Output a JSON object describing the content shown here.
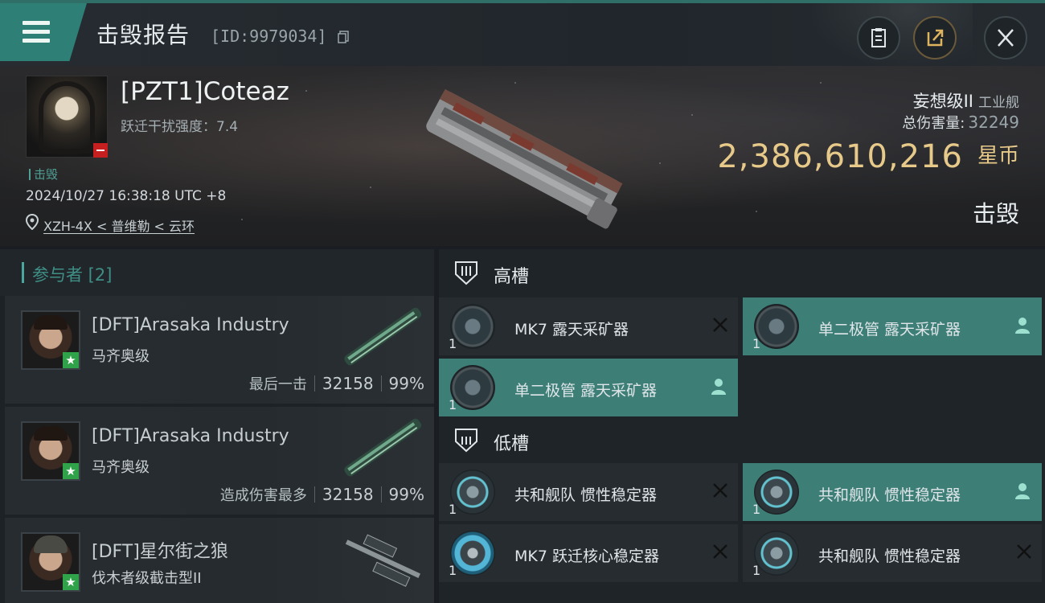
{
  "header": {
    "title": "击毁报告",
    "report_id": "[ID:9979034]"
  },
  "victim": {
    "name": "[PZT1]Coteaz",
    "warp_disruption": "跃迁干扰强度：7.4",
    "kill_tag": "击毁",
    "time": "2024/10/27 16:38:18 UTC +8",
    "location": "XZH-4X < 普维勒 < 云环",
    "ship_name": "妄想级II",
    "ship_class": "工业舰",
    "total_damage_label": "总伤害量:",
    "total_damage": "32249",
    "isk_value": "2,386,610,216",
    "isk_unit": "星币",
    "status": "击毁"
  },
  "participants": {
    "title": "参与者 [2]",
    "rows": [
      {
        "name": "[DFT]Arasaka Industry",
        "ship": "马齐奥级",
        "label": "最后一击",
        "damage": "32158",
        "percent": "99%"
      },
      {
        "name": "[DFT]Arasaka Industry",
        "ship": "马齐奥级",
        "label": "造成伤害最多",
        "damage": "32158",
        "percent": "99%"
      },
      {
        "name": "[DFT]星尔街之狼",
        "ship": "伐木者级截击型II"
      }
    ]
  },
  "fitting": {
    "high_slot_title": "高槽",
    "low_slot_title": "低槽",
    "high": [
      {
        "name": "MK7 露天采矿器",
        "qty": "1",
        "state": "destroyed"
      },
      {
        "name": "单二极管 露天采矿器",
        "qty": "1",
        "state": "dropped"
      },
      {
        "name": "单二极管 露天采矿器",
        "qty": "1",
        "state": "dropped"
      }
    ],
    "low": [
      {
        "name": "共和舰队 惯性稳定器",
        "qty": "1",
        "state": "destroyed"
      },
      {
        "name": "共和舰队 惯性稳定器",
        "qty": "1",
        "state": "dropped"
      },
      {
        "name": "MK7 跃迁核心稳定器",
        "qty": "1",
        "state": "destroyed"
      },
      {
        "name": "共和舰队 惯性稳定器",
        "qty": "1",
        "state": "destroyed"
      }
    ]
  },
  "colors": {
    "accent": "#2e7f76",
    "highlight_row": "#3d7f77",
    "isk_gold": "#e7c98a",
    "flag_red": "#c61f1f",
    "standing_green": "#2fa24a"
  }
}
